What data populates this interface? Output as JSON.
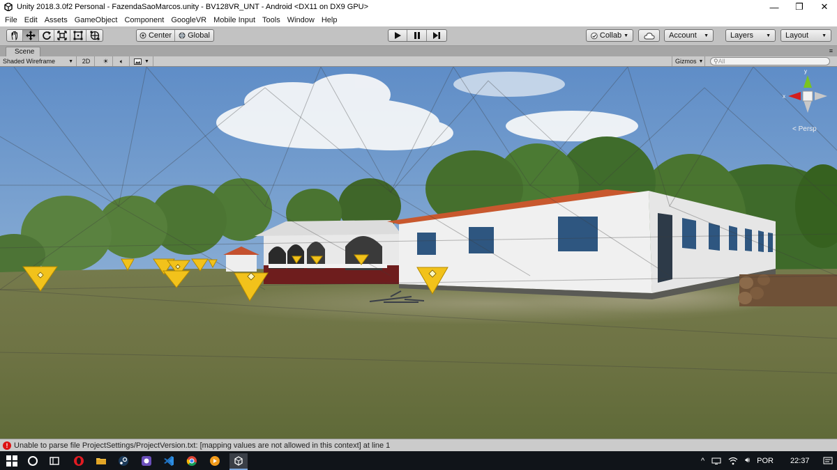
{
  "window": {
    "title": "Unity 2018.3.0f2 Personal - FazendaSaoMarcos.unity - BV128VR_UNT - Android <DX11 on DX9 GPU>",
    "controls": {
      "minimize": "—",
      "maximize": "❐",
      "close": "✕"
    }
  },
  "menu": [
    "File",
    "Edit",
    "Assets",
    "GameObject",
    "Component",
    "GoogleVR",
    "Mobile Input",
    "Tools",
    "Window",
    "Help"
  ],
  "toolbar": {
    "tools": [
      "hand-tool",
      "move-tool",
      "rotate-tool",
      "scale-tool",
      "rect-tool",
      "transform-tool"
    ],
    "active_tool": "move-tool",
    "pivot_label": "Center",
    "space_label": "Global",
    "collab_label": "Collab",
    "account_label": "Account",
    "layers_label": "Layers",
    "layout_label": "Layout"
  },
  "scene_tab": {
    "label": "Scene"
  },
  "scene_toolbar": {
    "draw_mode": "Shaded Wireframe",
    "mode_2d": "2D",
    "gizmos_label": "Gizmos",
    "search_placeholder": "All"
  },
  "viewport": {
    "projection_label": "< Persp",
    "sky_color": "#6f98c9",
    "grass_color": "#6b7141"
  },
  "status": {
    "message": "Unable to parse file ProjectSettings/ProjectVersion.txt: [mapping values are not allowed in this context] at line 1",
    "level": "error",
    "error_color": "#d11f1f"
  },
  "taskbar": {
    "apps": [
      "windows-start-icon",
      "cortana-icon",
      "task-view-icon",
      "opera-icon",
      "file-explorer-icon",
      "steam-icon",
      "app-purple-icon",
      "vscode-icon",
      "chrome-icon",
      "app-orange-icon",
      "unity-icon"
    ],
    "language": "POR",
    "time": "22:37"
  }
}
